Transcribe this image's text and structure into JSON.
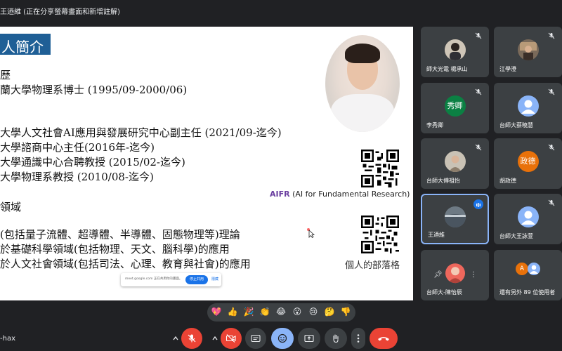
{
  "window": {
    "title": "王迺維 (正在分享螢幕畫面和新增註解)"
  },
  "slide": {
    "heading": "人簡介",
    "lines": [
      "歷",
      "蘭大學物理系博士 (1995/09-2000/06)",
      "",
      "大學人文社會AI應用與發展研究中心副主任 (2021/09-迄今)",
      "大學諮商中心主任(2016年-迄今)",
      "大學通識中心合聘教授 (2015/02-迄今)",
      "大學物理系教授 (2010/08-迄今)",
      "領域",
      "(包括量子流體、超導體、半導體、固態物理等)理論",
      "於基礎科學領域(包括物理、天文、腦科學)的應用",
      "於人文社會領域(包括司法、心理、教育與社會)的應用"
    ],
    "aifr_bold": "AIFR",
    "aifr_rest": " (AI for Fundamental Research)",
    "blog_caption": "個人的部落格"
  },
  "share_bar": {
    "text": "meet.google.com 正在共用你的畫面。",
    "stop_label": "停止共用",
    "hide_label": "隱藏"
  },
  "participants": [
    {
      "name": "師大光電 楊承山",
      "avatar_type": "photo",
      "muted": true
    },
    {
      "name": "江學澄",
      "avatar_type": "photo",
      "muted": true
    },
    {
      "name": "李秀卿",
      "avatar_text": "秀卿",
      "avatar_color": "#0b8043",
      "muted": true
    },
    {
      "name": "台師大蔡曉慧",
      "avatar_type": "person",
      "avatar_color": "#8ab4f8",
      "muted": true
    },
    {
      "name": "台師大傅祖怡",
      "avatar_type": "photo",
      "muted": true
    },
    {
      "name": "胡政德",
      "avatar_text": "政德",
      "avatar_color": "#e8710a",
      "muted": true
    },
    {
      "name": "王迺維",
      "avatar_type": "photo",
      "speaking": true
    },
    {
      "name": "台師大王詠萱",
      "avatar_type": "person",
      "avatar_color": "#8ab4f8",
      "muted": true
    },
    {
      "name": "台師大-陳怡辰",
      "avatar_type": "photo",
      "pin_icon": "pin-icon",
      "more_icon": "more-vert-icon"
    },
    {
      "name": "還有另外 89 位使用者",
      "avatar_text": "A",
      "avatar_color": "#e8710a"
    }
  ],
  "reactions": [
    "💖",
    "👍",
    "🎉",
    "👏",
    "😂",
    "😮",
    "😢",
    "🤔",
    "👎"
  ],
  "bottom_bar": {
    "meeting_code": "-hax",
    "controls": [
      {
        "icon": "mic-off-icon"
      },
      {
        "icon": "camera-off-icon"
      },
      {
        "icon": "captions-icon"
      },
      {
        "icon": "emoji-icon"
      },
      {
        "icon": "present-icon"
      },
      {
        "icon": "raise-hand-icon"
      },
      {
        "icon": "more-options-icon"
      },
      {
        "icon": "end-call-icon"
      }
    ]
  },
  "colors": {
    "accent": "#8ab4f8",
    "end_call": "#ea4335",
    "tile_bg": "#3c4043"
  }
}
